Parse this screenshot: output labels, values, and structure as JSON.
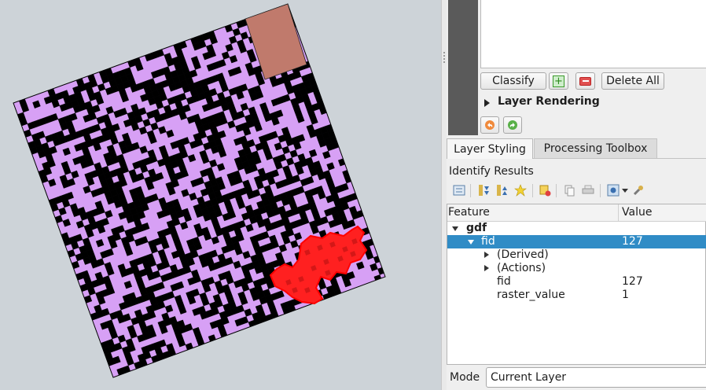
{
  "renderer": {
    "buttons": {
      "classify": "Classify",
      "add_class": "add-class",
      "remove_class": "remove-class",
      "delete_all": "Delete All"
    },
    "section_layer_rendering": "Layer Rendering",
    "undo_icon": "undo-icon",
    "redo_icon": "redo-icon"
  },
  "tabs": [
    {
      "label": "Layer Styling",
      "active": true
    },
    {
      "label": "Processing Toolbox",
      "active": false
    }
  ],
  "identify": {
    "title": "Identify Results",
    "toolbar_icons": [
      "expand-tree-icon",
      "expand-all-icon",
      "collapse-all-icon",
      "select-features-icon",
      "clear-results-icon",
      "copy-feature-icon",
      "print-icon",
      "identify-settings-icon",
      "dropdown-arrow-icon",
      "settings-wrench-icon"
    ],
    "columns": {
      "feature": "Feature",
      "value": "Value"
    },
    "rows": [
      {
        "feature": "gdf",
        "value": ""
      },
      {
        "feature": "fid",
        "value": "127"
      },
      {
        "feature": "(Derived)",
        "value": ""
      },
      {
        "feature": "(Actions)",
        "value": ""
      },
      {
        "feature": "fid",
        "value": "127"
      },
      {
        "feature": "raster_value",
        "value": "1"
      }
    ],
    "mode_label": "Mode",
    "mode_value": "Current Layer"
  },
  "map": {
    "colors": {
      "background": "#cdd3d8",
      "raster_class_a": "#d7a0f5",
      "raster_class_b": "#000000",
      "corner_patch": "#c07a6c",
      "highlight": "#ff0000"
    }
  },
  "theme": {
    "selection": "#308cc6"
  }
}
